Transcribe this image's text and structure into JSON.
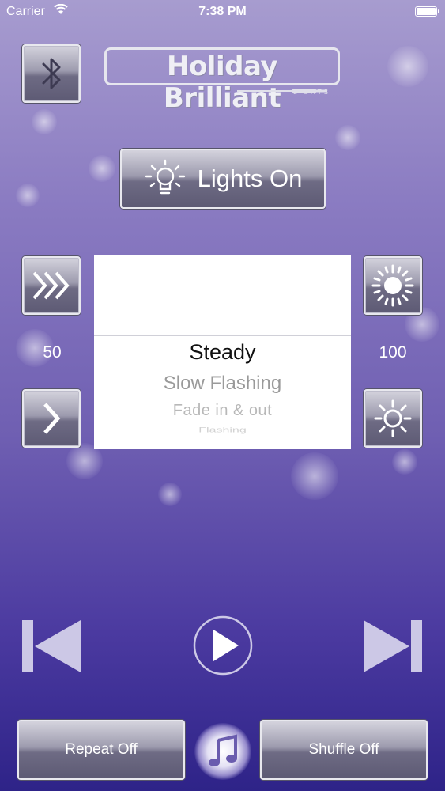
{
  "status_bar": {
    "carrier": "Carrier",
    "time": "7:38 PM"
  },
  "header": {
    "logo_text": "Holiday Brilliant",
    "logo_subtext": "LIGHTS",
    "bluetooth_icon": "bluetooth-icon"
  },
  "lights_button": {
    "label": "Lights On",
    "icon": "lightbulb-icon"
  },
  "speed": {
    "faster_icon": "triple-chevron-right-icon",
    "slower_icon": "chevron-right-icon",
    "value": "50"
  },
  "brightness": {
    "up_icon": "sun-large-icon",
    "down_icon": "sun-small-icon",
    "value": "100"
  },
  "mode_picker": {
    "selected": "Steady",
    "options_below": [
      "Slow Flashing",
      "Fade in & out",
      "Flashing"
    ]
  },
  "transport": {
    "prev_icon": "skip-previous-icon",
    "play_icon": "play-icon",
    "next_icon": "skip-next-icon"
  },
  "bottom_bar": {
    "repeat_label": "Repeat Off",
    "shuffle_label": "Shuffle Off",
    "music_icon": "music-note-icon"
  },
  "colors": {
    "background_top": "#a79ccf",
    "background_bottom": "#2e2388",
    "button_metal": "#9d9bae"
  }
}
